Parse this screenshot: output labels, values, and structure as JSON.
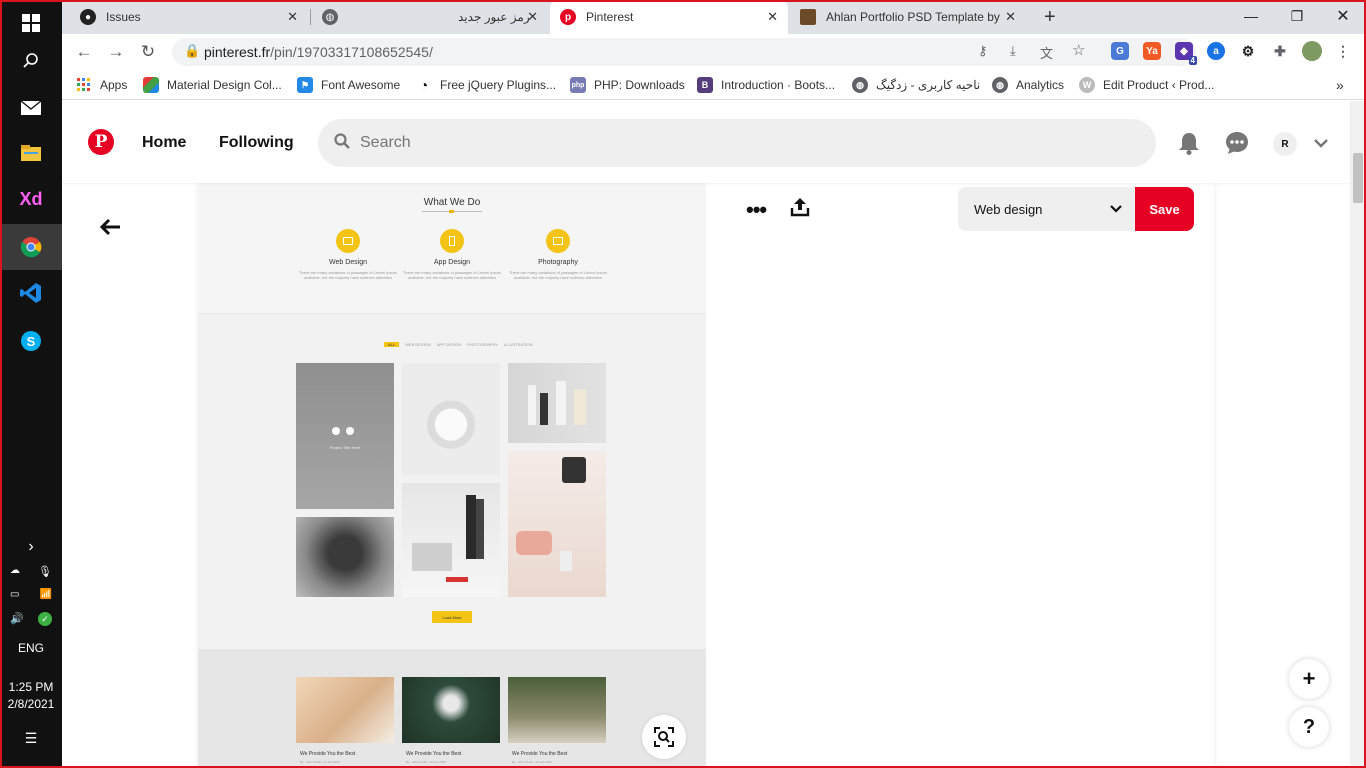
{
  "taskbar": {
    "icons": [
      "windows-start-icon",
      "search-icon",
      "mail-icon",
      "file-explorer-icon",
      "adobe-xd-icon",
      "chrome-icon",
      "vscode-icon",
      "skype-icon",
      "notification-icon"
    ],
    "xd_label": "Xd",
    "skype_label": "S",
    "tray_expand": "›",
    "language": "ENG",
    "time": "1:25 PM",
    "date": "2/8/2021"
  },
  "browser": {
    "tabs": [
      {
        "title": "Issues",
        "icon": "github-icon",
        "active": false
      },
      {
        "title": "رمز عبور جدید",
        "icon": "globe-icon",
        "active": false
      },
      {
        "title": "Pinterest",
        "icon": "pinterest-icon",
        "active": true
      },
      {
        "title": "Ahlan Portfolio PSD Template by",
        "icon": "page-thumb-icon",
        "active": false
      }
    ],
    "new_tab_label": "+",
    "url_host": "pinterest.fr",
    "url_path": "/pin/19703317108652545/",
    "bookmarks": [
      {
        "label": "Apps",
        "icon": "apps-grid-icon"
      },
      {
        "label": "Material Design Col...",
        "icon": "material-palette-icon"
      },
      {
        "label": "Font Awesome",
        "icon": "flag-icon"
      },
      {
        "label": "Free jQuery Plugins...",
        "icon": "jquery-icon"
      },
      {
        "label": "PHP: Downloads",
        "icon": "php-icon"
      },
      {
        "label": "Introduction · Boots...",
        "icon": "bootstrap-icon"
      },
      {
        "label": "ناحیه کاربری - زدگیگ",
        "icon": "globe-icon"
      },
      {
        "label": "Analytics",
        "icon": "globe-icon"
      },
      {
        "label": "Edit Product ‹ Prod...",
        "icon": "wordpress-icon"
      }
    ],
    "extensions_badge": "4",
    "colors": {
      "tab_strip": "#dee1e6",
      "omnibox": "#f1f3f4"
    }
  },
  "pinterest": {
    "nav": {
      "home": "Home",
      "following": "Following"
    },
    "search_placeholder": "Search",
    "avatar_initial": "R",
    "board_name": "Web design",
    "save_label": "Save",
    "fab_add": "+",
    "fab_help": "?",
    "colors": {
      "brand": "#e60023"
    }
  },
  "pin_image": {
    "section_title": "What We Do",
    "services": [
      {
        "name": "Web Design",
        "desc": "There are many variations of passages of Lorem Ipsum available, but the majority have suffered alteration"
      },
      {
        "name": "App Design",
        "desc": "There are many variations of passages of Lorem Ipsum available, but the majority have suffered alteration"
      },
      {
        "name": "Photography",
        "desc": "There are many variations of passages of Lorem Ipsum available, but the majority have suffered alteration"
      }
    ],
    "filters": [
      "ALL",
      "WEB DESIGN",
      "APP DESIGN",
      "PHOTOGRAPHY",
      "ILLUSTRATION"
    ],
    "portfolio_overlay": "Project Title Here",
    "load_more": "Load More",
    "team": [
      {
        "name": "We Provide You the Best",
        "meta": "By : John Smith | 14 Jan 2016"
      },
      {
        "name": "We Provide You the Best",
        "meta": "By : John Smith | 14 Jan 2016"
      },
      {
        "name": "We Provide You the Best",
        "meta": "By : John Smith | 14 Jan 2016"
      }
    ],
    "accent": "#f3c315"
  }
}
